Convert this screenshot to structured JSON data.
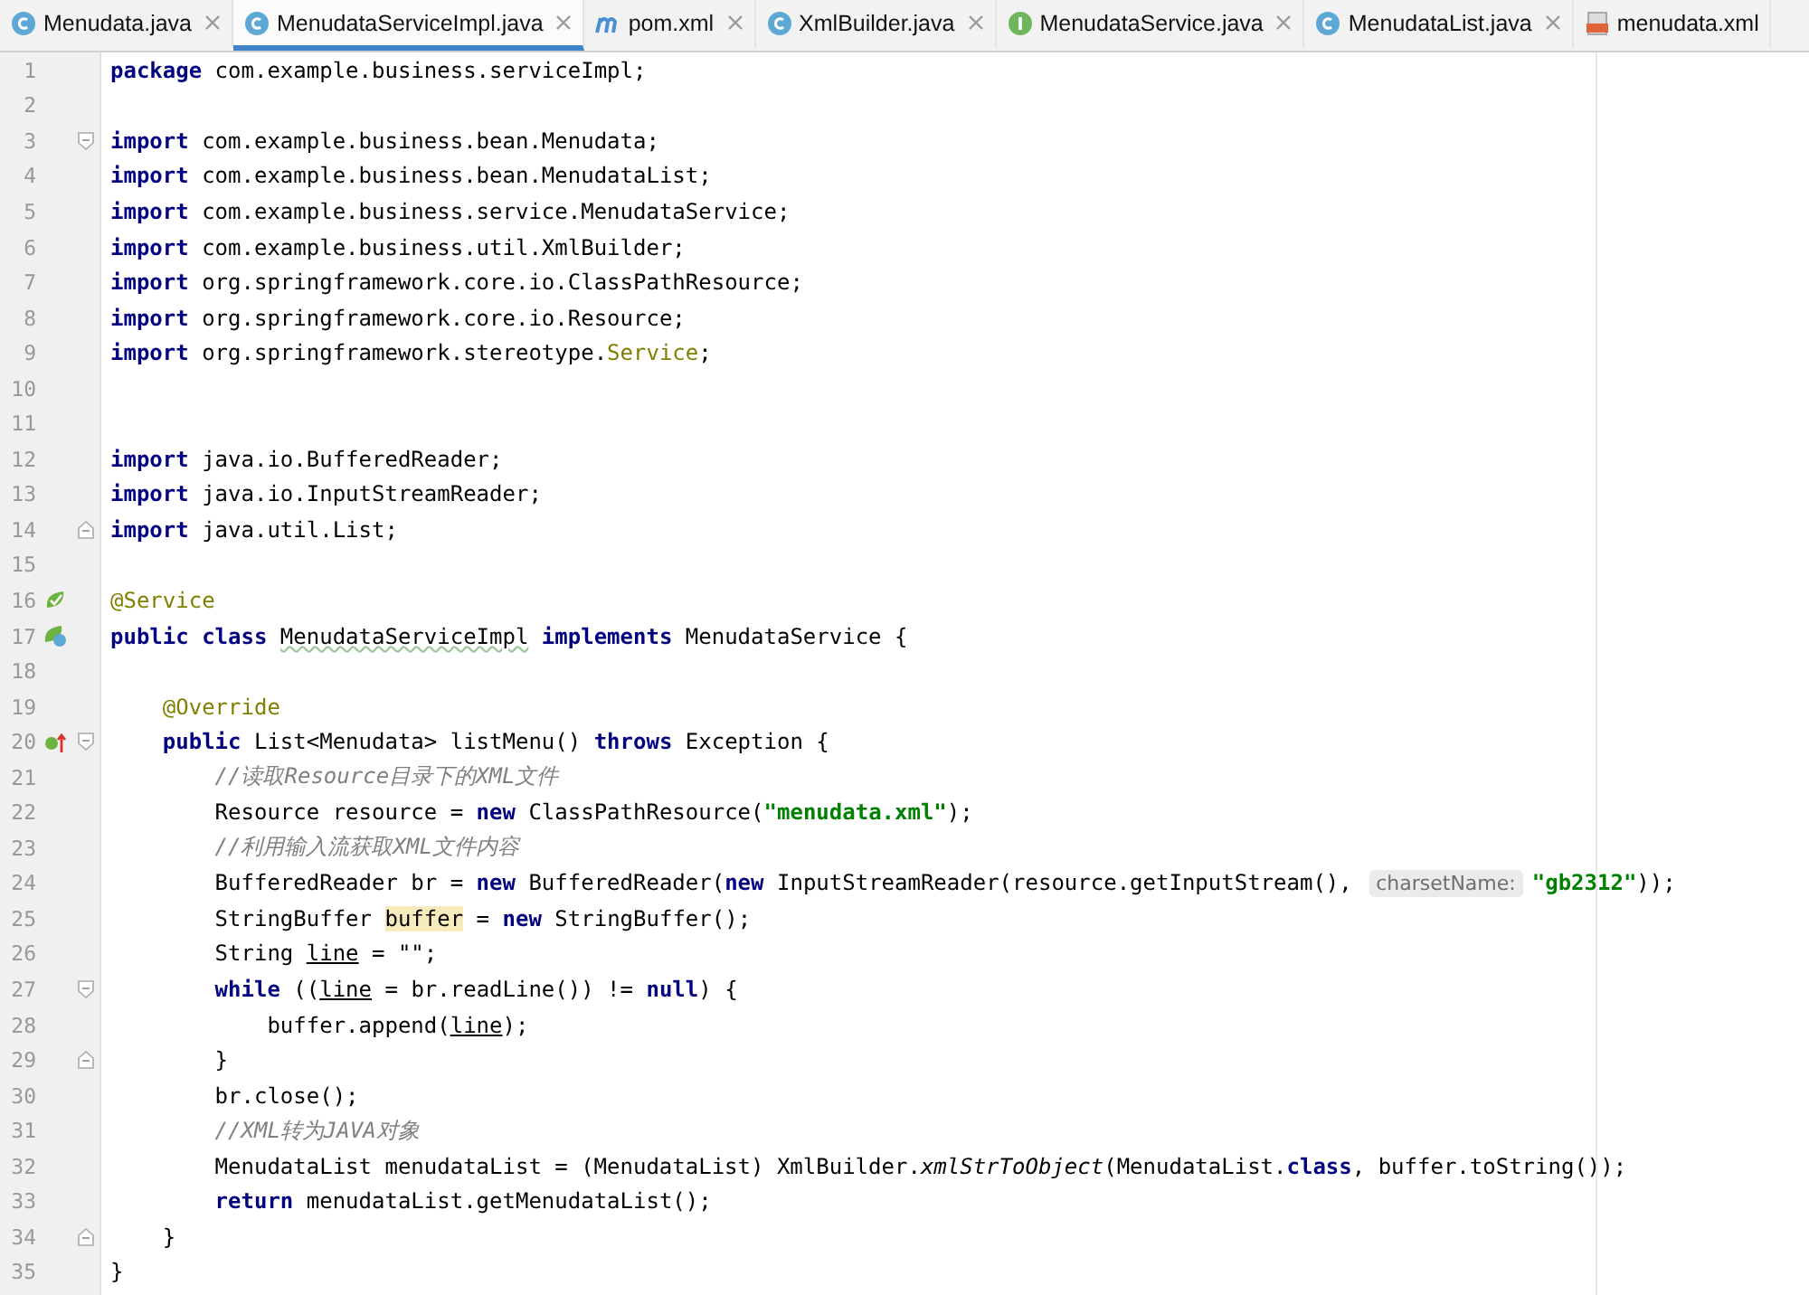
{
  "tabs": [
    {
      "label": "Menudata.java",
      "kind": "class",
      "selected": false
    },
    {
      "label": "MenudataServiceImpl.java",
      "kind": "class",
      "selected": true
    },
    {
      "label": "pom.xml",
      "kind": "maven",
      "selected": false
    },
    {
      "label": "XmlBuilder.java",
      "kind": "class",
      "selected": false
    },
    {
      "label": "MenudataService.java",
      "kind": "interface",
      "selected": false
    },
    {
      "label": "MenudataList.java",
      "kind": "class",
      "selected": false
    },
    {
      "label": "menudata.xml",
      "kind": "xml",
      "selected": false
    }
  ],
  "editor": {
    "lines": [
      {
        "number": "1",
        "tokens": [
          {
            "kind": "keyword",
            "text": "package"
          },
          {
            "kind": "plain",
            "text": " com.example.business.serviceImpl;"
          }
        ]
      },
      {
        "number": "2"
      },
      {
        "number": "3",
        "tokens": [
          {
            "kind": "keyword",
            "text": "import"
          },
          {
            "kind": "plain",
            "text": " com.example.business.bean.Menudata;"
          }
        ]
      },
      {
        "number": "4",
        "tokens": [
          {
            "kind": "keyword",
            "text": "import"
          },
          {
            "kind": "plain",
            "text": " com.example.business.bean.MenudataList;"
          }
        ]
      },
      {
        "number": "5",
        "tokens": [
          {
            "kind": "keyword",
            "text": "import"
          },
          {
            "kind": "plain",
            "text": " com.example.business.service.MenudataService;"
          }
        ]
      },
      {
        "number": "6",
        "tokens": [
          {
            "kind": "keyword",
            "text": "import"
          },
          {
            "kind": "plain",
            "text": " com.example.business.util.XmlBuilder;"
          }
        ]
      },
      {
        "number": "7",
        "tokens": [
          {
            "kind": "keyword",
            "text": "import"
          },
          {
            "kind": "plain",
            "text": " org.springframework.core.io.ClassPathResource;"
          }
        ]
      },
      {
        "number": "8",
        "tokens": [
          {
            "kind": "keyword",
            "text": "import"
          },
          {
            "kind": "plain",
            "text": " org.springframework.core.io.Resource;"
          }
        ]
      },
      {
        "number": "9",
        "tokens": [
          {
            "kind": "keyword",
            "text": "import"
          },
          {
            "kind": "plain",
            "text": " org.springframework.stereotype."
          },
          {
            "kind": "annotation",
            "text": "Service"
          },
          {
            "kind": "plain",
            "text": ";"
          }
        ]
      },
      {
        "number": "10"
      },
      {
        "number": "11"
      },
      {
        "number": "12",
        "tokens": [
          {
            "kind": "keyword",
            "text": "import"
          },
          {
            "kind": "plain",
            "text": " java.io.BufferedReader;"
          }
        ]
      },
      {
        "number": "13",
        "tokens": [
          {
            "kind": "keyword",
            "text": "import"
          },
          {
            "kind": "plain",
            "text": " java.io.InputStreamReader;"
          }
        ]
      },
      {
        "number": "14",
        "tokens": [
          {
            "kind": "keyword",
            "text": "import"
          },
          {
            "kind": "plain",
            "text": " java.util.List;"
          }
        ]
      },
      {
        "number": "15"
      },
      {
        "number": "16",
        "tokens": [
          {
            "kind": "annotation",
            "text": "@Service"
          }
        ]
      },
      {
        "number": "17",
        "tokens": [
          {
            "kind": "keyword",
            "text": "public class "
          },
          {
            "kind": "typo",
            "text": "MenudataServiceImpl"
          },
          {
            "kind": "keyword",
            "text": " implements"
          },
          {
            "kind": "plain",
            "text": " MenudataService {"
          }
        ]
      },
      {
        "number": "18"
      },
      {
        "number": "19",
        "tokens": [
          {
            "kind": "annotation",
            "text": "    @Override"
          }
        ]
      },
      {
        "number": "20",
        "tokens": [
          {
            "kind": "keyword",
            "text": "    public"
          },
          {
            "kind": "plain",
            "text": " List<Menudata> listMenu() "
          },
          {
            "kind": "keyword",
            "text": "throws"
          },
          {
            "kind": "plain",
            "text": " Exception {"
          }
        ]
      },
      {
        "number": "21",
        "tokens": [
          {
            "kind": "comment",
            "text": "        //读取Resource目录下的XML文件"
          }
        ]
      },
      {
        "number": "22",
        "tokens": [
          {
            "kind": "plain",
            "text": "        Resource resource = "
          },
          {
            "kind": "keyword",
            "text": "new"
          },
          {
            "kind": "plain",
            "text": " ClassPathResource("
          },
          {
            "kind": "string",
            "text": "\"menudata.xml\""
          },
          {
            "kind": "plain",
            "text": ");"
          }
        ]
      },
      {
        "number": "23",
        "tokens": [
          {
            "kind": "comment",
            "text": "        //利用输入流获取XML文件内容"
          }
        ]
      },
      {
        "number": "24",
        "tokens": [
          {
            "kind": "plain",
            "text": "        BufferedReader br = "
          },
          {
            "kind": "keyword",
            "text": "new"
          },
          {
            "kind": "plain",
            "text": " BufferedReader("
          },
          {
            "kind": "keyword",
            "text": "new"
          },
          {
            "kind": "plain",
            "text": " InputStreamReader(resource.getInputStream(), "
          },
          {
            "kind": "hint",
            "text": "charsetName:"
          },
          {
            "kind": "string",
            "text": "\"gb2312\""
          },
          {
            "kind": "plain",
            "text": "));"
          }
        ]
      },
      {
        "number": "25",
        "tokens": [
          {
            "kind": "plain",
            "text": "        StringBuffer "
          },
          {
            "kind": "highlight",
            "text": "buffer"
          },
          {
            "kind": "plain",
            "text": " = "
          },
          {
            "kind": "keyword",
            "text": "new"
          },
          {
            "kind": "plain",
            "text": " StringBuffer();"
          }
        ]
      },
      {
        "number": "26",
        "tokens": [
          {
            "kind": "plain",
            "text": "        String "
          },
          {
            "kind": "underline",
            "text": "line"
          },
          {
            "kind": "plain",
            "text": " = \"\";"
          }
        ]
      },
      {
        "number": "27",
        "tokens": [
          {
            "kind": "keyword",
            "text": "        while"
          },
          {
            "kind": "plain",
            "text": " (("
          },
          {
            "kind": "underline",
            "text": "line"
          },
          {
            "kind": "plain",
            "text": " = br.readLine()) != "
          },
          {
            "kind": "keyword",
            "text": "null"
          },
          {
            "kind": "plain",
            "text": ") {"
          }
        ]
      },
      {
        "number": "28",
        "tokens": [
          {
            "kind": "plain",
            "text": "            buffer.append("
          },
          {
            "kind": "underline",
            "text": "line"
          },
          {
            "kind": "plain",
            "text": ");"
          }
        ]
      },
      {
        "number": "29",
        "tokens": [
          {
            "kind": "plain",
            "text": "        }"
          }
        ]
      },
      {
        "number": "30",
        "tokens": [
          {
            "kind": "plain",
            "text": "        br.close();"
          }
        ]
      },
      {
        "number": "31",
        "tokens": [
          {
            "kind": "comment",
            "text": "        //XML转为JAVA对象"
          }
        ]
      },
      {
        "number": "32",
        "tokens": [
          {
            "kind": "plain",
            "text": "        MenudataList menudataList = (MenudataList) XmlBuilder."
          },
          {
            "kind": "italic",
            "text": "xmlStrToObject"
          },
          {
            "kind": "plain",
            "text": "(MenudataList."
          },
          {
            "kind": "keyword",
            "text": "class"
          },
          {
            "kind": "plain",
            "text": ", buffer.toString());"
          }
        ]
      },
      {
        "number": "33",
        "tokens": [
          {
            "kind": "keyword",
            "text": "        return"
          },
          {
            "kind": "plain",
            "text": " menudataList.getMenudataList();"
          }
        ]
      },
      {
        "number": "34",
        "tokens": [
          {
            "kind": "plain",
            "text": "    }"
          }
        ]
      },
      {
        "number": "35",
        "tokens": [
          {
            "kind": "plain",
            "text": "}"
          }
        ]
      }
    ]
  }
}
